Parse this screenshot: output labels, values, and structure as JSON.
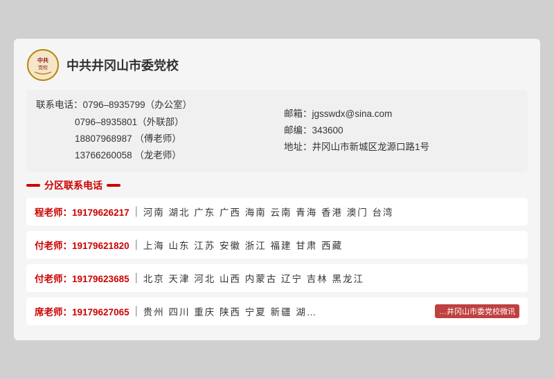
{
  "header": {
    "school_name": "中共井冈山市委党校"
  },
  "info": {
    "phone_label": "联系电话：",
    "phone1": "0796–8935799（办公室）",
    "phone2": "0796–8935801（外联部）",
    "phone3": "18807968987 （傅老师）",
    "phone4": "13766260058 （龙老师）",
    "email_label": "邮箱：",
    "email": "jgsswdx@sina.com",
    "postcode_label": "邮编：",
    "postcode": "343600",
    "address_label": "地址：",
    "address": "井冈山市新城区龙源口路1号"
  },
  "section_title": "分区联系电话",
  "contacts": [
    {
      "name": "程老师：19179626217",
      "regions": "河南   湖北   广东   广西   海南   云南   青海   香港   澳门   台湾"
    },
    {
      "name": "付老师：19179621820",
      "regions": "上海   山东   江苏   安徽   浙江   福建   甘肃   西藏"
    },
    {
      "name": "付老师：19179623685",
      "regions": "北京   天津   河北   山西   内蒙古   辽宁   吉林   黑龙江"
    },
    {
      "name": "席老师：19179627065",
      "regions": "贵州   四川   重庆   陕西   宁夏   新疆   湖…"
    }
  ],
  "watermark": "…井冈山市委党校微讯"
}
